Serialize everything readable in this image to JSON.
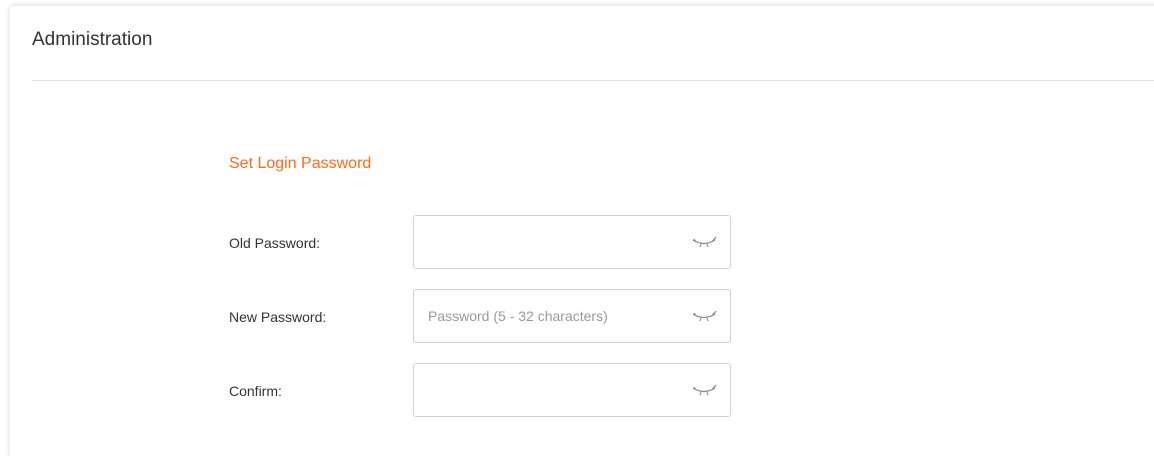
{
  "page": {
    "title": "Administration"
  },
  "section": {
    "title": "Set Login Password"
  },
  "fields": {
    "old_password": {
      "label": "Old Password:",
      "value": "",
      "placeholder": ""
    },
    "new_password": {
      "label": "New Password:",
      "value": "",
      "placeholder": "Password (5 - 32 characters)"
    },
    "confirm": {
      "label": "Confirm:",
      "value": "",
      "placeholder": ""
    }
  },
  "icons": {
    "visibility_toggle": "eye-closed-icon"
  },
  "colors": {
    "accent": "#ff6a1a",
    "text": "#333333",
    "placeholder": "#999999",
    "border": "#d2d2d2",
    "divider": "#e6e6e6"
  }
}
